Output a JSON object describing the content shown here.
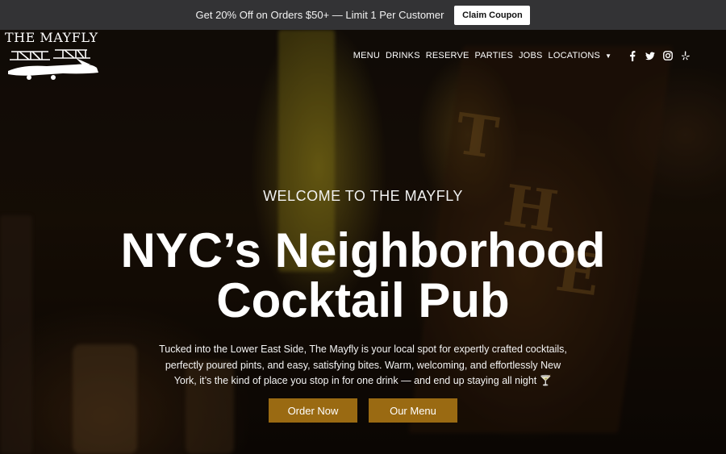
{
  "promo": {
    "text": "Get 20% Off on Orders $50+ — Limit 1 Per Customer",
    "button_label": "Claim Coupon"
  },
  "brand": {
    "logo_text": "THE MAYFLY"
  },
  "nav": {
    "items": [
      "MENU",
      "DRINKS",
      "RESERVE",
      "PARTIES",
      "JOBS",
      "LOCATIONS"
    ],
    "social_icons": [
      "facebook-icon",
      "twitter-icon",
      "instagram-icon",
      "yelp-icon"
    ]
  },
  "hero": {
    "eyebrow": "WELCOME TO THE MAYFLY",
    "headline_line1": "NYC’s Neighborhood",
    "headline_line2": "Cocktail Pub",
    "description": "Tucked into the Lower East Side, The Mayfly is your local spot for expertly crafted cocktails, perfectly poured pints, and easy, satisfying bites. Warm, welcoming, and effortlessly New York, it’s the kind of place you stop in for one drink — and end up staying all night 🍸",
    "buttons": [
      "Order Now",
      "Our Menu"
    ]
  },
  "colors": {
    "promo_bg": "#333335",
    "accent": "#9a6a12"
  }
}
